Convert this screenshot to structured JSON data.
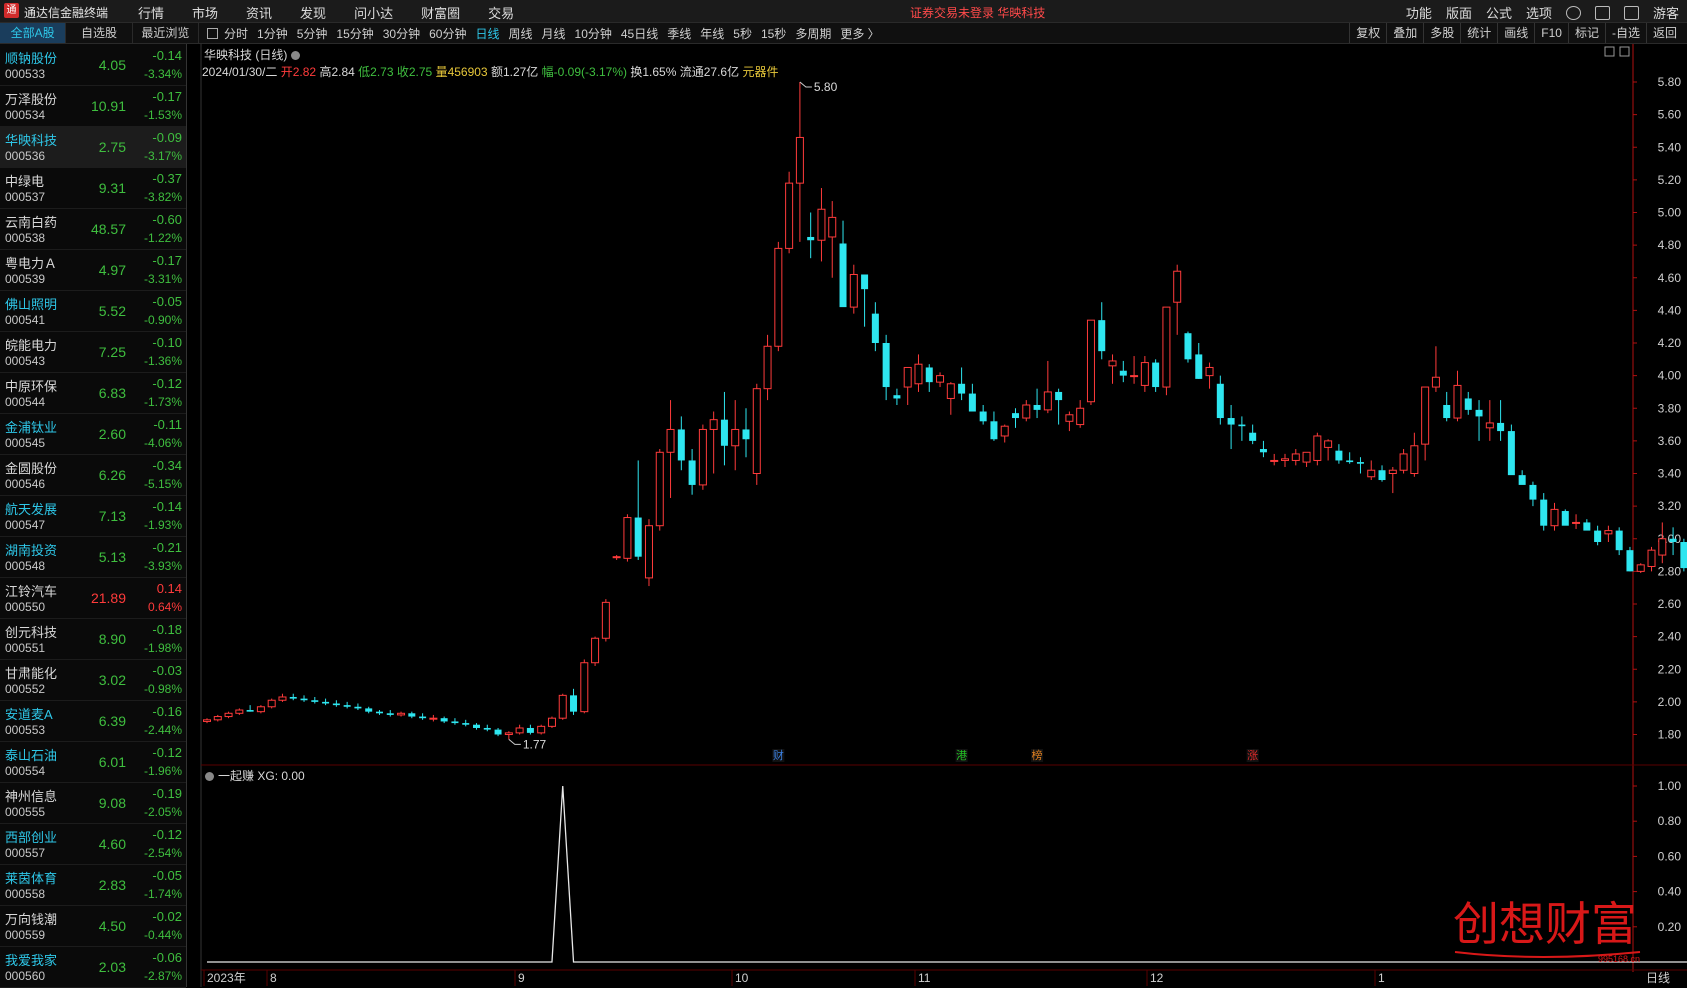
{
  "app": {
    "title": "通达信金融终端",
    "logo": "通"
  },
  "menu": [
    "行情",
    "市场",
    "资讯",
    "发现",
    "问小达",
    "财富圈",
    "交易"
  ],
  "notice": "证券交易未登录  华映科技",
  "right_menu": [
    "功能",
    "版面",
    "公式",
    "选项",
    "游客"
  ],
  "list_tabs": [
    {
      "label": "全部A股",
      "active": true
    },
    {
      "label": "自选股",
      "active": false
    },
    {
      "label": "最近浏览",
      "active": false
    }
  ],
  "period_tabs": [
    {
      "label": "分时",
      "active": false
    },
    {
      "label": "1分钟",
      "active": false
    },
    {
      "label": "5分钟",
      "active": false
    },
    {
      "label": "15分钟",
      "active": false
    },
    {
      "label": "30分钟",
      "active": false
    },
    {
      "label": "60分钟",
      "active": false
    },
    {
      "label": "日线",
      "active": true
    },
    {
      "label": "周线",
      "active": false
    },
    {
      "label": "月线",
      "active": false
    },
    {
      "label": "10分钟",
      "active": false
    },
    {
      "label": "45日线",
      "active": false
    },
    {
      "label": "季线",
      "active": false
    },
    {
      "label": "年线",
      "active": false
    },
    {
      "label": "5秒",
      "active": false
    },
    {
      "label": "15秒",
      "active": false
    },
    {
      "label": "多周期",
      "active": false
    },
    {
      "label": "更多 〉",
      "active": false
    }
  ],
  "right_tools": [
    "复权",
    "叠加",
    "多股",
    "统计",
    "画线",
    "F10",
    "标记",
    "-自选",
    "返回"
  ],
  "stocks": [
    {
      "name": "顺钠股份",
      "code": "000533",
      "price": "4.05",
      "change": "-0.14",
      "pct": "-3.34%",
      "dir": "dn",
      "hl": true,
      "sel": false
    },
    {
      "name": "万泽股份",
      "code": "000534",
      "price": "10.91",
      "change": "-0.17",
      "pct": "-1.53%",
      "dir": "dn",
      "hl": false,
      "sel": false
    },
    {
      "name": "华映科技",
      "code": "000536",
      "price": "2.75",
      "change": "-0.09",
      "pct": "-3.17%",
      "dir": "dn",
      "hl": true,
      "sel": true
    },
    {
      "name": "中绿电",
      "code": "000537",
      "price": "9.31",
      "change": "-0.37",
      "pct": "-3.82%",
      "dir": "dn",
      "hl": false,
      "sel": false
    },
    {
      "name": "云南白药",
      "code": "000538",
      "price": "48.57",
      "change": "-0.60",
      "pct": "-1.22%",
      "dir": "dn",
      "hl": false,
      "sel": false
    },
    {
      "name": "粤电力Ａ",
      "code": "000539",
      "price": "4.97",
      "change": "-0.17",
      "pct": "-3.31%",
      "dir": "dn",
      "hl": false,
      "sel": false
    },
    {
      "name": "佛山照明",
      "code": "000541",
      "price": "5.52",
      "change": "-0.05",
      "pct": "-0.90%",
      "dir": "dn",
      "hl": true,
      "sel": false
    },
    {
      "name": "皖能电力",
      "code": "000543",
      "price": "7.25",
      "change": "-0.10",
      "pct": "-1.36%",
      "dir": "dn",
      "hl": false,
      "sel": false
    },
    {
      "name": "中原环保",
      "code": "000544",
      "price": "6.83",
      "change": "-0.12",
      "pct": "-1.73%",
      "dir": "dn",
      "hl": false,
      "sel": false
    },
    {
      "name": "金浦钛业",
      "code": "000545",
      "price": "2.60",
      "change": "-0.11",
      "pct": "-4.06%",
      "dir": "dn",
      "hl": true,
      "sel": false
    },
    {
      "name": "金圆股份",
      "code": "000546",
      "price": "6.26",
      "change": "-0.34",
      "pct": "-5.15%",
      "dir": "dn",
      "hl": false,
      "sel": false
    },
    {
      "name": "航天发展",
      "code": "000547",
      "price": "7.13",
      "change": "-0.14",
      "pct": "-1.93%",
      "dir": "dn",
      "hl": true,
      "sel": false
    },
    {
      "name": "湖南投资",
      "code": "000548",
      "price": "5.13",
      "change": "-0.21",
      "pct": "-3.93%",
      "dir": "dn",
      "hl": true,
      "sel": false
    },
    {
      "name": "江铃汽车",
      "code": "000550",
      "price": "21.89",
      "change": "0.14",
      "pct": "0.64%",
      "dir": "up",
      "hl": false,
      "sel": false
    },
    {
      "name": "创元科技",
      "code": "000551",
      "price": "8.90",
      "change": "-0.18",
      "pct": "-1.98%",
      "dir": "dn",
      "hl": false,
      "sel": false
    },
    {
      "name": "甘肃能化",
      "code": "000552",
      "price": "3.02",
      "change": "-0.03",
      "pct": "-0.98%",
      "dir": "dn",
      "hl": false,
      "sel": false
    },
    {
      "name": "安道麦A",
      "code": "000553",
      "price": "6.39",
      "change": "-0.16",
      "pct": "-2.44%",
      "dir": "dn",
      "hl": true,
      "sel": false
    },
    {
      "name": "泰山石油",
      "code": "000554",
      "price": "6.01",
      "change": "-0.12",
      "pct": "-1.96%",
      "dir": "dn",
      "hl": true,
      "sel": false
    },
    {
      "name": "神州信息",
      "code": "000555",
      "price": "9.08",
      "change": "-0.19",
      "pct": "-2.05%",
      "dir": "dn",
      "hl": false,
      "sel": false
    },
    {
      "name": "西部创业",
      "code": "000557",
      "price": "4.60",
      "change": "-0.12",
      "pct": "-2.54%",
      "dir": "dn",
      "hl": true,
      "sel": false
    },
    {
      "name": "莱茵体育",
      "code": "000558",
      "price": "2.83",
      "change": "-0.05",
      "pct": "-1.74%",
      "dir": "dn",
      "hl": true,
      "sel": false
    },
    {
      "name": "万向钱潮",
      "code": "000559",
      "price": "4.50",
      "change": "-0.02",
      "pct": "-0.44%",
      "dir": "dn",
      "hl": false,
      "sel": false
    },
    {
      "name": "我爱我家",
      "code": "000560",
      "price": "2.03",
      "change": "-0.06",
      "pct": "-2.87%",
      "dir": "dn",
      "hl": true,
      "sel": false
    }
  ],
  "chart_header": {
    "title": "华映科技 (日线)",
    "date": "2024/01/30/二",
    "open": "开2.82",
    "high": "高2.84",
    "low": "低2.73",
    "close": "收2.75",
    "volume": "量456903",
    "amount": "额1.27亿",
    "change": "幅-0.09(-3.17%)",
    "turnover": "换1.65%",
    "float": "流通27.6亿",
    "sector": "元器件"
  },
  "indicator_header": {
    "name": "一起赚",
    "value": "XG: 0.00"
  },
  "colors": {
    "up": "#ff3b3b",
    "down": "#2ee6f0",
    "bg": "#000000",
    "grid": "#2a0a0a",
    "axis": "#b01010",
    "accent": "#2ec7e8"
  },
  "chart_data": [
    {
      "type": "candlestick",
      "title": "华映科技 (日线)",
      "yticks": [
        1.8,
        2.0,
        2.2,
        2.4,
        2.6,
        2.8,
        3.0,
        3.2,
        3.4,
        3.6,
        3.8,
        4.0,
        4.2,
        4.4,
        4.6,
        4.8,
        5.0,
        5.2,
        5.4,
        5.6,
        5.8
      ],
      "ylim": [
        1.67,
        5.88
      ],
      "annotations": [
        {
          "label": "5.80",
          "value": 5.8
        },
        {
          "label": "1.77",
          "value": 1.77
        }
      ],
      "event_markers": [
        "财",
        "港",
        "榜",
        "涨"
      ],
      "x_labels": [
        "2023年",
        "8",
        "9",
        "10",
        "11",
        "12",
        "1"
      ],
      "period_label": "日线",
      "ohlc": [
        [
          1.88,
          1.9,
          1.87,
          1.89
        ],
        [
          1.89,
          1.92,
          1.88,
          1.91
        ],
        [
          1.91,
          1.94,
          1.9,
          1.93
        ],
        [
          1.93,
          1.96,
          1.92,
          1.95
        ],
        [
          1.95,
          1.98,
          1.94,
          1.94
        ],
        [
          1.94,
          1.98,
          1.93,
          1.97
        ],
        [
          1.97,
          2.02,
          1.96,
          2.01
        ],
        [
          2.01,
          2.05,
          2.0,
          2.03
        ],
        [
          2.03,
          2.05,
          2.01,
          2.02
        ],
        [
          2.02,
          2.04,
          2.0,
          2.01
        ],
        [
          2.01,
          2.03,
          1.99,
          2.0
        ],
        [
          2.0,
          2.02,
          1.98,
          1.99
        ],
        [
          1.99,
          2.01,
          1.97,
          1.98
        ],
        [
          1.98,
          2.0,
          1.96,
          1.97
        ],
        [
          1.97,
          1.99,
          1.95,
          1.96
        ],
        [
          1.96,
          1.97,
          1.93,
          1.94
        ],
        [
          1.94,
          1.95,
          1.92,
          1.93
        ],
        [
          1.93,
          1.95,
          1.91,
          1.92
        ],
        [
          1.92,
          1.94,
          1.91,
          1.93
        ],
        [
          1.93,
          1.94,
          1.9,
          1.91
        ],
        [
          1.91,
          1.93,
          1.89,
          1.9
        ],
        [
          1.9,
          1.92,
          1.88,
          1.9
        ],
        [
          1.9,
          1.91,
          1.87,
          1.88
        ],
        [
          1.88,
          1.9,
          1.86,
          1.87
        ],
        [
          1.87,
          1.89,
          1.85,
          1.86
        ],
        [
          1.86,
          1.87,
          1.83,
          1.84
        ],
        [
          1.84,
          1.86,
          1.82,
          1.83
        ],
        [
          1.83,
          1.84,
          1.79,
          1.8
        ],
        [
          1.8,
          1.82,
          1.77,
          1.81
        ],
        [
          1.81,
          1.86,
          1.8,
          1.84
        ],
        [
          1.84,
          1.86,
          1.8,
          1.81
        ],
        [
          1.81,
          1.86,
          1.8,
          1.85
        ],
        [
          1.85,
          1.91,
          1.84,
          1.9
        ],
        [
          1.9,
          2.05,
          1.89,
          2.04
        ],
        [
          2.04,
          2.08,
          1.92,
          1.94
        ],
        [
          1.94,
          2.26,
          1.93,
          2.24
        ],
        [
          2.24,
          2.4,
          2.22,
          2.39
        ],
        [
          2.39,
          2.63,
          2.37,
          2.61
        ],
        [
          2.89,
          2.9,
          2.87,
          2.89
        ],
        [
          2.88,
          3.15,
          2.86,
          3.13
        ],
        [
          3.13,
          3.48,
          2.87,
          2.89
        ],
        [
          2.76,
          3.12,
          2.71,
          3.08
        ],
        [
          3.08,
          3.55,
          3.05,
          3.53
        ],
        [
          3.53,
          3.85,
          3.25,
          3.67
        ],
        [
          3.67,
          3.75,
          3.42,
          3.48
        ],
        [
          3.48,
          3.55,
          3.27,
          3.33
        ],
        [
          3.33,
          3.7,
          3.3,
          3.67
        ],
        [
          3.67,
          3.78,
          3.4,
          3.73
        ],
        [
          3.73,
          3.9,
          3.45,
          3.57
        ],
        [
          3.57,
          3.85,
          3.42,
          3.67
        ],
        [
          3.67,
          3.8,
          3.5,
          3.61
        ],
        [
          3.4,
          3.95,
          3.33,
          3.92
        ],
        [
          3.92,
          4.25,
          3.85,
          4.18
        ],
        [
          4.18,
          4.82,
          4.15,
          4.78
        ],
        [
          4.78,
          5.25,
          4.75,
          5.18
        ],
        [
          5.18,
          5.8,
          4.82,
          5.46
        ],
        [
          4.85,
          5.0,
          4.72,
          4.83
        ],
        [
          4.83,
          5.15,
          4.7,
          5.02
        ],
        [
          4.85,
          5.07,
          4.6,
          4.97
        ],
        [
          4.81,
          4.95,
          4.55,
          4.42
        ],
        [
          4.42,
          4.68,
          4.38,
          4.62
        ],
        [
          4.62,
          4.62,
          4.3,
          4.53
        ],
        [
          4.38,
          4.45,
          4.15,
          4.2
        ],
        [
          4.2,
          4.25,
          3.85,
          3.93
        ],
        [
          3.88,
          3.92,
          3.82,
          3.86
        ],
        [
          3.93,
          4.05,
          3.82,
          4.05
        ],
        [
          3.95,
          4.13,
          3.9,
          4.07
        ],
        [
          4.05,
          4.07,
          3.9,
          3.96
        ],
        [
          3.96,
          4.02,
          3.93,
          4.0
        ],
        [
          3.86,
          3.96,
          3.76,
          3.95
        ],
        [
          3.95,
          4.05,
          3.85,
          3.89
        ],
        [
          3.89,
          3.95,
          3.8,
          3.78
        ],
        [
          3.78,
          3.82,
          3.7,
          3.72
        ],
        [
          3.72,
          3.78,
          3.6,
          3.61
        ],
        [
          3.63,
          3.7,
          3.59,
          3.69
        ],
        [
          3.77,
          3.8,
          3.68,
          3.74
        ],
        [
          3.74,
          3.85,
          3.72,
          3.82
        ],
        [
          3.82,
          3.92,
          3.74,
          3.79
        ],
        [
          3.79,
          4.09,
          3.77,
          3.9
        ],
        [
          3.9,
          3.92,
          3.7,
          3.85
        ],
        [
          3.72,
          3.78,
          3.66,
          3.76
        ],
        [
          3.7,
          3.85,
          3.68,
          3.8
        ],
        [
          3.84,
          4.21,
          3.82,
          4.34
        ],
        [
          4.34,
          4.45,
          4.1,
          4.15
        ],
        [
          4.06,
          4.13,
          3.95,
          4.09
        ],
        [
          4.03,
          4.09,
          3.96,
          4.0
        ],
        [
          4.0,
          4.12,
          3.95,
          4.0
        ],
        [
          3.94,
          4.12,
          3.9,
          4.08
        ],
        [
          4.08,
          4.1,
          3.9,
          3.93
        ],
        [
          3.93,
          4.18,
          3.88,
          4.42
        ],
        [
          4.45,
          4.68,
          4.25,
          4.64
        ],
        [
          4.26,
          4.27,
          4.08,
          4.1
        ],
        [
          4.13,
          4.2,
          3.98,
          3.98
        ],
        [
          4.0,
          4.08,
          3.92,
          4.05
        ],
        [
          3.95,
          4.0,
          3.7,
          3.74
        ],
        [
          3.74,
          3.82,
          3.55,
          3.7
        ],
        [
          3.7,
          3.75,
          3.6,
          3.69
        ],
        [
          3.65,
          3.7,
          3.58,
          3.6
        ],
        [
          3.55,
          3.6,
          3.5,
          3.53
        ],
        [
          3.48,
          3.52,
          3.45,
          3.48
        ],
        [
          3.48,
          3.52,
          3.44,
          3.49
        ],
        [
          3.48,
          3.55,
          3.45,
          3.52
        ],
        [
          3.47,
          3.52,
          3.44,
          3.53
        ],
        [
          3.48,
          3.65,
          3.45,
          3.63
        ],
        [
          3.56,
          3.61,
          3.48,
          3.6
        ],
        [
          3.54,
          3.58,
          3.46,
          3.48
        ],
        [
          3.48,
          3.53,
          3.46,
          3.47
        ],
        [
          3.47,
          3.5,
          3.4,
          3.46
        ],
        [
          3.38,
          3.48,
          3.36,
          3.42
        ],
        [
          3.42,
          3.45,
          3.35,
          3.36
        ],
        [
          3.4,
          3.44,
          3.28,
          3.42
        ],
        [
          3.42,
          3.55,
          3.4,
          3.52
        ],
        [
          3.4,
          3.65,
          3.38,
          3.57
        ],
        [
          3.58,
          3.85,
          3.48,
          3.93
        ],
        [
          3.93,
          4.18,
          3.9,
          3.99
        ],
        [
          3.82,
          3.9,
          3.72,
          3.74
        ],
        [
          3.74,
          4.03,
          3.72,
          3.94
        ],
        [
          3.86,
          3.9,
          3.76,
          3.79
        ],
        [
          3.79,
          3.85,
          3.6,
          3.75
        ],
        [
          3.68,
          3.85,
          3.6,
          3.71
        ],
        [
          3.71,
          3.85,
          3.6,
          3.66
        ],
        [
          3.66,
          3.7,
          3.4,
          3.39
        ],
        [
          3.39,
          3.42,
          3.34,
          3.33
        ],
        [
          3.33,
          3.35,
          3.2,
          3.24
        ],
        [
          3.24,
          3.28,
          3.05,
          3.08
        ],
        [
          3.08,
          3.22,
          3.05,
          3.18
        ],
        [
          3.17,
          3.18,
          3.1,
          3.08
        ],
        [
          3.1,
          3.15,
          3.06,
          3.1
        ],
        [
          3.1,
          3.12,
          3.07,
          3.05
        ],
        [
          3.05,
          3.08,
          2.96,
          2.98
        ],
        [
          3.03,
          3.08,
          2.98,
          3.05
        ],
        [
          3.05,
          3.07,
          2.9,
          2.93
        ],
        [
          2.93,
          2.95,
          2.8,
          2.8
        ],
        [
          2.8,
          2.85,
          2.79,
          2.84
        ],
        [
          2.83,
          2.95,
          2.8,
          2.93
        ],
        [
          2.9,
          3.1,
          2.85,
          3.0
        ],
        [
          3.0,
          3.07,
          2.9,
          2.98
        ],
        [
          2.98,
          3.0,
          2.8,
          2.82
        ],
        [
          2.82,
          2.84,
          2.73,
          2.75
        ]
      ]
    },
    {
      "type": "line",
      "title": "一起赚",
      "series": [
        {
          "name": "XG",
          "values": "0 everywhere except a single 1.00 spike near the start of 9"
        }
      ],
      "yticks": [
        0.2,
        0.4,
        0.6,
        0.8,
        1.0
      ],
      "ylim": [
        -0.02,
        1.05
      ],
      "spike_index": 33
    }
  ],
  "watermark": {
    "text": "创想财富",
    "url": "995168.cn"
  }
}
